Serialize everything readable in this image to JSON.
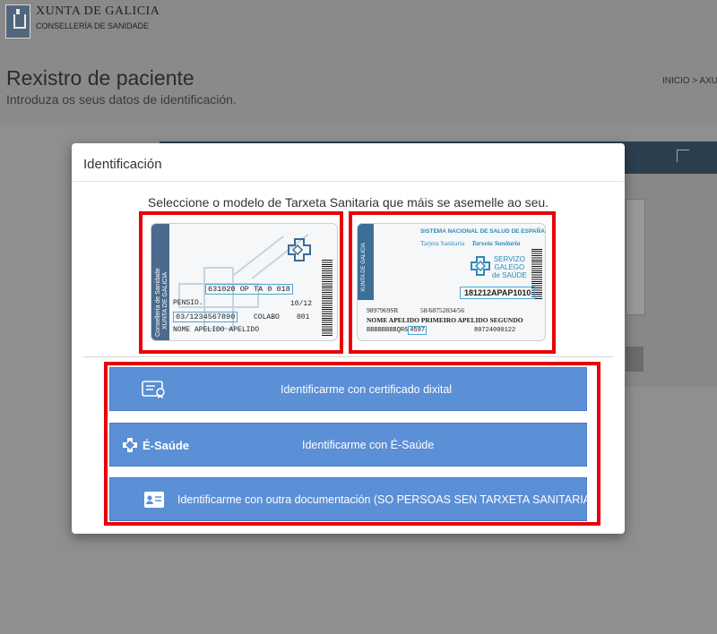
{
  "header": {
    "logo_title": "XUNTA DE GALICIA",
    "logo_subtitle": "CONSELLERÍA DE SANIDADE"
  },
  "page": {
    "title": "Rexistro de paciente",
    "subtitle": "Introduza os seus datos de identificación.",
    "breadcrumb": "INICIO > AXU"
  },
  "modal": {
    "title": "Identificación",
    "instruction": "Seleccione o modelo de Tarxeta Sanitaria que máis se asemelle ao seu.",
    "card1": {
      "strip_text_1": "Consellería de Sanidade",
      "strip_text_2": "XUNTA DE GALICIA",
      "number": "631020  OP  TA  0  018",
      "pensio": "PENSIO.",
      "date": "10/12",
      "id": "03/1234567890",
      "colabo": "COLABO",
      "colabo_val": "001",
      "name": "NOME   APELIDO   APELIDO"
    },
    "card2": {
      "strip_text": "XUNTA DE GALICIA",
      "header": "SISTEMA NACIONAL DE SALUD DE ESPAÑA",
      "tarjeta": "Tarjeta Sanitaria",
      "tarxeta": "Tarxeta Sanitaria",
      "servizo": [
        "SERVIZO",
        "GALEGO",
        "de SAÚDE"
      ],
      "id": "181212APAP1010",
      "line1_a": "9897969SR",
      "line1_b": "58/68752834/56",
      "line2": "NOME APELIDO PRIMEIRO APELIDO SEGUNDO",
      "line3_a": "BBBBBBBBQR6",
      "line3_hl": "4597",
      "line3_b": "80724000122"
    },
    "options": [
      {
        "label": "Identificarme con certificado dixital",
        "icon": "certificate-icon"
      },
      {
        "label": "Identificarme con É-Saúde",
        "logo": "É-Saúde",
        "icon": "esaude-cross-icon"
      },
      {
        "label": "Identificarme con outra documentación (SO PERSOAS SEN TARXETA SANITARIA)",
        "icon": "id-card-icon"
      }
    ]
  },
  "colors": {
    "button": "#5b8fd6",
    "highlight": "#e8000b",
    "card_blue": "#4c6a8d"
  }
}
